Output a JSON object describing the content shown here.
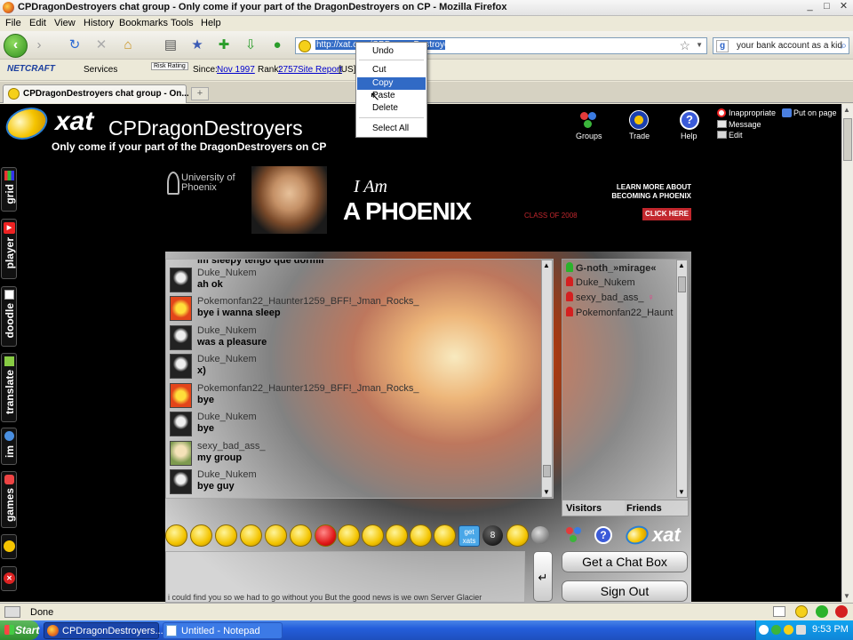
{
  "window": {
    "title": "CPDragonDestroyers chat group - Only come if your part of the DragonDestroyers on CP - Mozilla Firefox"
  },
  "menubar": [
    "File",
    "Edit",
    "View",
    "History",
    "Bookmarks",
    "Tools",
    "Help"
  ],
  "navbar": {
    "url": "http://xat.com/CPDragonDestroyers",
    "search_text": "your bank account as a kid"
  },
  "netcraft": {
    "logo": "NETCRAFT",
    "services": "Services",
    "risk": "Risk Rating",
    "since_label": "Since:",
    "since_value": "Nov 1997",
    "rank_label": "Rank:",
    "rank_value": "2757",
    "site_report": "Site Report",
    "country": "[US]"
  },
  "tab": {
    "label": "CPDragonDestroyers chat group - On..."
  },
  "context_menu": {
    "items": [
      "Undo",
      "Cut",
      "Copy",
      "Paste",
      "Delete",
      "Select All"
    ],
    "highlighted": "Copy"
  },
  "xat": {
    "logo": "xat",
    "group_name": "CPDragonDestroyers",
    "tagline": "Only come if your part of the DragonDestroyers on CP",
    "top_icons": [
      "Groups",
      "Trade",
      "Help"
    ],
    "right_links": [
      "Inappropriate",
      "Put on page",
      "Message",
      "Edit"
    ],
    "left_tabs": [
      "grid",
      "player",
      "doodle",
      "translate",
      "im",
      "games"
    ],
    "ad": {
      "brand": "University of Phoenix",
      "headline_small": "I Am",
      "headline": "A PHOENIX",
      "class_of": "CLASS OF 2008",
      "learn_more": "LEARN MORE ABOUT BECOMING A PHOENIX",
      "click_here": "CLICK HERE"
    },
    "partial_top_line": "Im sleepy tengo que dormir",
    "messages": [
      {
        "name": "Duke_Nukem",
        "text": "ah ok",
        "avatar": "skull"
      },
      {
        "name": "Pokemonfan22_Haunter1259_BFF!_Jman_Rocks_",
        "text": "bye i wanna sleep",
        "avatar": "pokemon"
      },
      {
        "name": "Duke_Nukem",
        "text": "was a pleasure",
        "avatar": "skull"
      },
      {
        "name": "Duke_Nukem",
        "text": "x)",
        "avatar": "skull"
      },
      {
        "name": "Pokemonfan22_Haunter1259_BFF!_Jman_Rocks_",
        "text": "bye",
        "avatar": "pokemon"
      },
      {
        "name": "Duke_Nukem",
        "text": "bye",
        "avatar": "skull"
      },
      {
        "name": "sexy_bad_ass_",
        "text": "my group",
        "avatar": "girl"
      },
      {
        "name": "Duke_Nukem",
        "text": "bye guy",
        "avatar": "skull"
      }
    ],
    "users": [
      {
        "name": "G-noth_»mirage«",
        "color": "#2bb32b",
        "bold": true
      },
      {
        "name": "Duke_Nukem",
        "color": "#d42020",
        "bold": false
      },
      {
        "name": "sexy_bad_ass_",
        "color": "#d42020",
        "bold": false
      },
      {
        "name": "Pokemonfan22_Haunt",
        "color": "#d42020",
        "bold": false
      }
    ],
    "user_tabs": [
      "Visitors",
      "Friends"
    ],
    "get_xats": "get xats",
    "input_text": "i could find you so we had to go without you But the good news is we own Server Glacier",
    "buttons": {
      "get_chat_box": "Get a Chat Box",
      "sign_out": "Sign Out"
    }
  },
  "status": {
    "text": "Done"
  },
  "taskbar": {
    "start": "Start",
    "items": [
      "CPDragonDestroyers...",
      "Untitled - Notepad"
    ],
    "time": "9:53 PM"
  }
}
